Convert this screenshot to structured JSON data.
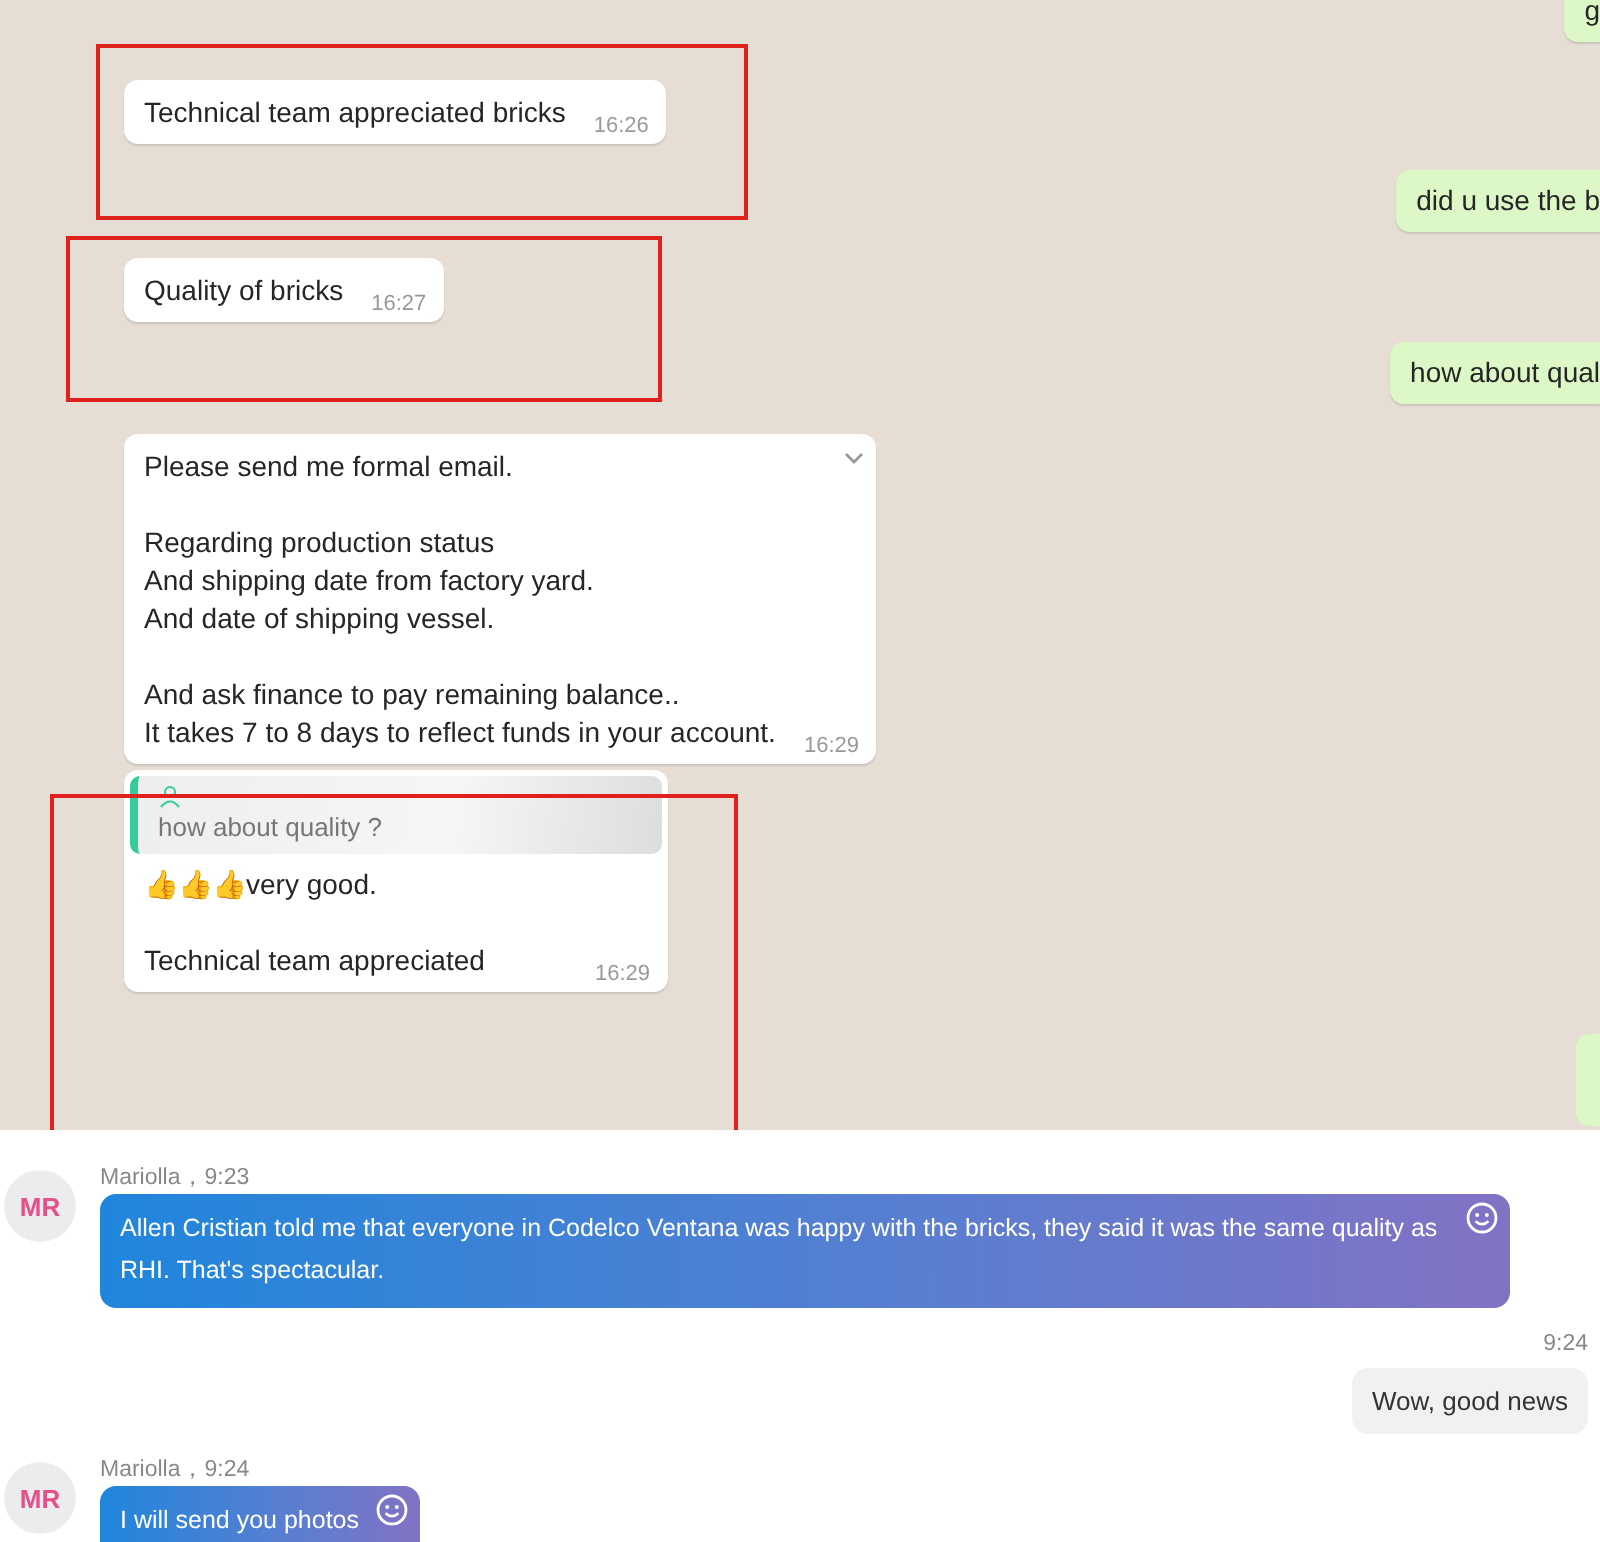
{
  "whatsapp_chat": {
    "incoming": [
      {
        "text": "Technical team appreciated bricks",
        "time": "16:26",
        "highlighted": true
      },
      {
        "text": "Quality of bricks",
        "time": "16:27",
        "highlighted": true
      },
      {
        "text": "Please send me formal email.\n\nRegarding production status\nAnd shipping date from factory yard.\nAnd date of shipping vessel.\n\nAnd ask finance to pay remaining balance..\nIt takes 7 to 8 days to reflect funds in your account.",
        "time": "16:29",
        "highlighted": false
      },
      {
        "kind": "reply",
        "quote": "how about quality ?",
        "text": "👍👍👍very good.\n\nTechnical team appreciated",
        "time": "16:29",
        "highlighted": true
      }
    ],
    "outgoing": [
      {
        "text": "g"
      },
      {
        "text": "did u use the b"
      },
      {
        "text": "how about qual"
      }
    ]
  },
  "im_chat": {
    "messages": [
      {
        "kind": "incoming",
        "avatar": "MR",
        "sender": "Mariolla，9:23",
        "text": "Allen Cristian told me that everyone in Codelco Ventana was happy with the bricks, they said it was the same quality as RHI. That's spectacular."
      },
      {
        "kind": "outgoing",
        "time": "9:24",
        "text": "Wow, good news"
      },
      {
        "kind": "incoming",
        "avatar": "MR",
        "sender": "Mariolla，9:24",
        "text": "I will send you photos"
      }
    ]
  }
}
